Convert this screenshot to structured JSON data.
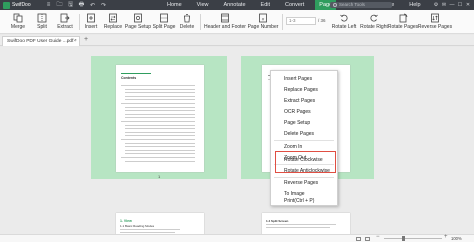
{
  "app": {
    "logo_text": "SwifDoo"
  },
  "titlebar_controls": [
    "≡",
    "🗀",
    "🖫",
    "🖶",
    "↶",
    "↷"
  ],
  "menu": [
    {
      "label": "Home",
      "active": false
    },
    {
      "label": "View",
      "active": false
    },
    {
      "label": "Annotate",
      "active": false
    },
    {
      "label": "Edit",
      "active": false
    },
    {
      "label": "Convert",
      "active": false
    },
    {
      "label": "Page",
      "active": true
    },
    {
      "label": "Protect",
      "active": false
    },
    {
      "label": "Share",
      "active": false
    },
    {
      "label": "Help",
      "active": false
    }
  ],
  "search": {
    "placeholder": "Search Tools"
  },
  "window_controls": [
    "⚙",
    "✉",
    "—",
    "☐",
    "✕"
  ],
  "toolbar": {
    "merge": "Merge",
    "split": "Split",
    "extract": "Extract",
    "insert": "Insert",
    "replace": "Replace",
    "page_setup": "Page Setup",
    "split_page": "Split Page",
    "delete": "Delete",
    "header_footer": "Header and Footer",
    "page_number": "Page Number",
    "page_input": "1-3",
    "page_total": "/ 36",
    "rotate_left": "Rotate Left",
    "rotate_right": "Rotate Right",
    "rotate_pages": "Rotate Pages",
    "reverse_pages": "Reverse Pages"
  },
  "tab": {
    "label": "SwifDoo PDF User Guide ...pdf *",
    "close": "×",
    "add": "+"
  },
  "thumbnails": [
    {
      "page_number": "1",
      "heading": "Contents"
    },
    {
      "page_number": "2",
      "heading": ""
    }
  ],
  "lower_pages": [
    {
      "heading": "1. View",
      "subheading": "1.1 Basic Reading Modes"
    },
    {
      "heading": "1.4 Split Screen",
      "subheading": ""
    }
  ],
  "context_menu": {
    "items": [
      "Insert Pages",
      "Replace Pages",
      "Extract Pages",
      "OCR Pages",
      "Page Setup",
      "Delete Pages",
      "Zoom In",
      "Zoom Out",
      "Rotate Clockwise",
      "Rotate Anticlockwise",
      "Reverse Pages",
      "To Image",
      "Print(Ctrl + P)"
    ]
  },
  "status": {
    "zoom_minus": "−",
    "zoom_plus": "+",
    "zoom_value": "100%"
  },
  "colors": {
    "accent": "#2f9d5e",
    "thumb_bg": "#b7e5c3",
    "highlight": "#e04e42"
  }
}
